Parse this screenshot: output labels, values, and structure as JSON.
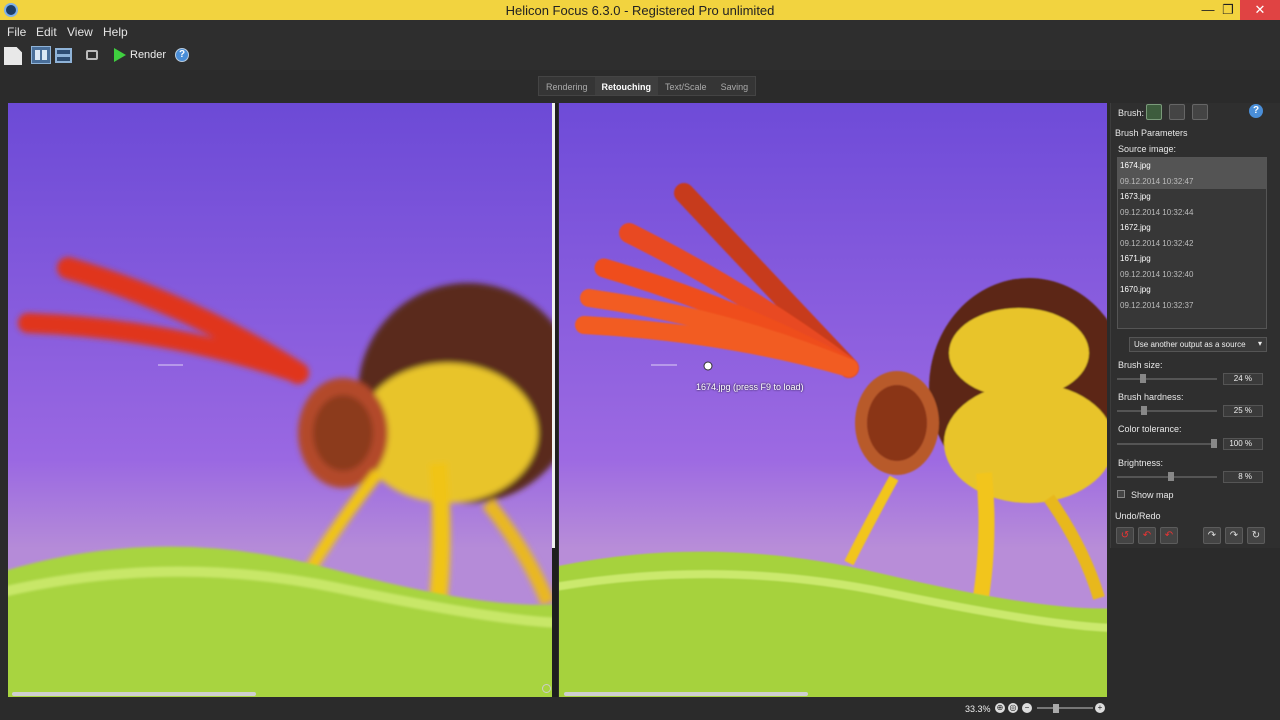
{
  "window": {
    "title": "Helicon Focus 6.3.0 - Registered Pro unlimited",
    "minimize": "—",
    "maximize": "❐",
    "close": "✕"
  },
  "menu": {
    "file": "File",
    "edit": "Edit",
    "view": "View",
    "help": "Help"
  },
  "toolbar": {
    "render_label": "Render",
    "help_glyph": "?"
  },
  "tabs": [
    {
      "label": "Rendering"
    },
    {
      "label": "Retouching",
      "active": true
    },
    {
      "label": "Text/Scale"
    },
    {
      "label": "Saving"
    }
  ],
  "viewer": {
    "cursor_hint": "1674.jpg (press F9 to load)"
  },
  "panel": {
    "brush_label": "Brush:",
    "help_glyph": "?",
    "brush_parameters": "Brush Parameters",
    "source_image_label": "Source image:",
    "sources": [
      {
        "name": "1674.jpg",
        "date": "09.12.2014 10:32:47"
      },
      {
        "name": "1673.jpg",
        "date": "09.12.2014 10:32:44"
      },
      {
        "name": "1672.jpg",
        "date": "09.12.2014 10:32:42"
      },
      {
        "name": "1671.jpg",
        "date": "09.12.2014 10:32:40"
      },
      {
        "name": "1670.jpg",
        "date": "09.12.2014 10:32:37"
      }
    ],
    "dropdown": "Use another output as a source",
    "brush_size": {
      "label": "Brush size:",
      "value": "24 %",
      "fraction": 0.24
    },
    "brush_hardness": {
      "label": "Brush hardness:",
      "value": "25 %",
      "fraction": 0.25
    },
    "color_tolerance": {
      "label": "Color tolerance:",
      "value": "100 %",
      "fraction": 1.0
    },
    "brightness": {
      "label": "Brightness:",
      "value": "8 %",
      "fraction": 0.54
    },
    "show_map": "Show map",
    "undo_redo": "Undo/Redo"
  },
  "status": {
    "zoom": "33.3%"
  }
}
